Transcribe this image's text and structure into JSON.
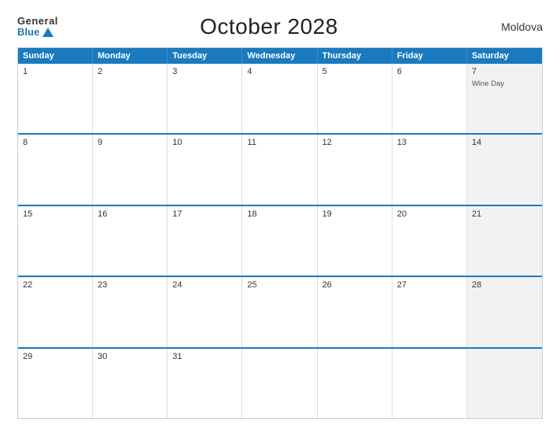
{
  "logo": {
    "general": "General",
    "blue": "Blue"
  },
  "title": "October 2028",
  "country": "Moldova",
  "header": {
    "days": [
      "Sunday",
      "Monday",
      "Tuesday",
      "Wednesday",
      "Thursday",
      "Friday",
      "Saturday"
    ]
  },
  "weeks": [
    [
      {
        "day": "1",
        "shaded": false,
        "events": []
      },
      {
        "day": "2",
        "shaded": false,
        "events": []
      },
      {
        "day": "3",
        "shaded": false,
        "events": []
      },
      {
        "day": "4",
        "shaded": false,
        "events": []
      },
      {
        "day": "5",
        "shaded": false,
        "events": []
      },
      {
        "day": "6",
        "shaded": false,
        "events": []
      },
      {
        "day": "7",
        "shaded": true,
        "events": [
          "Wine Day"
        ]
      }
    ],
    [
      {
        "day": "8",
        "shaded": false,
        "events": []
      },
      {
        "day": "9",
        "shaded": false,
        "events": []
      },
      {
        "day": "10",
        "shaded": false,
        "events": []
      },
      {
        "day": "11",
        "shaded": false,
        "events": []
      },
      {
        "day": "12",
        "shaded": false,
        "events": []
      },
      {
        "day": "13",
        "shaded": false,
        "events": []
      },
      {
        "day": "14",
        "shaded": true,
        "events": []
      }
    ],
    [
      {
        "day": "15",
        "shaded": false,
        "events": []
      },
      {
        "day": "16",
        "shaded": false,
        "events": []
      },
      {
        "day": "17",
        "shaded": false,
        "events": []
      },
      {
        "day": "18",
        "shaded": false,
        "events": []
      },
      {
        "day": "19",
        "shaded": false,
        "events": []
      },
      {
        "day": "20",
        "shaded": false,
        "events": []
      },
      {
        "day": "21",
        "shaded": true,
        "events": []
      }
    ],
    [
      {
        "day": "22",
        "shaded": false,
        "events": []
      },
      {
        "day": "23",
        "shaded": false,
        "events": []
      },
      {
        "day": "24",
        "shaded": false,
        "events": []
      },
      {
        "day": "25",
        "shaded": false,
        "events": []
      },
      {
        "day": "26",
        "shaded": false,
        "events": []
      },
      {
        "day": "27",
        "shaded": false,
        "events": []
      },
      {
        "day": "28",
        "shaded": true,
        "events": []
      }
    ],
    [
      {
        "day": "29",
        "shaded": false,
        "events": []
      },
      {
        "day": "30",
        "shaded": false,
        "events": []
      },
      {
        "day": "31",
        "shaded": false,
        "events": []
      },
      {
        "day": "",
        "shaded": false,
        "events": []
      },
      {
        "day": "",
        "shaded": false,
        "events": []
      },
      {
        "day": "",
        "shaded": false,
        "events": []
      },
      {
        "day": "",
        "shaded": true,
        "events": []
      }
    ]
  ]
}
